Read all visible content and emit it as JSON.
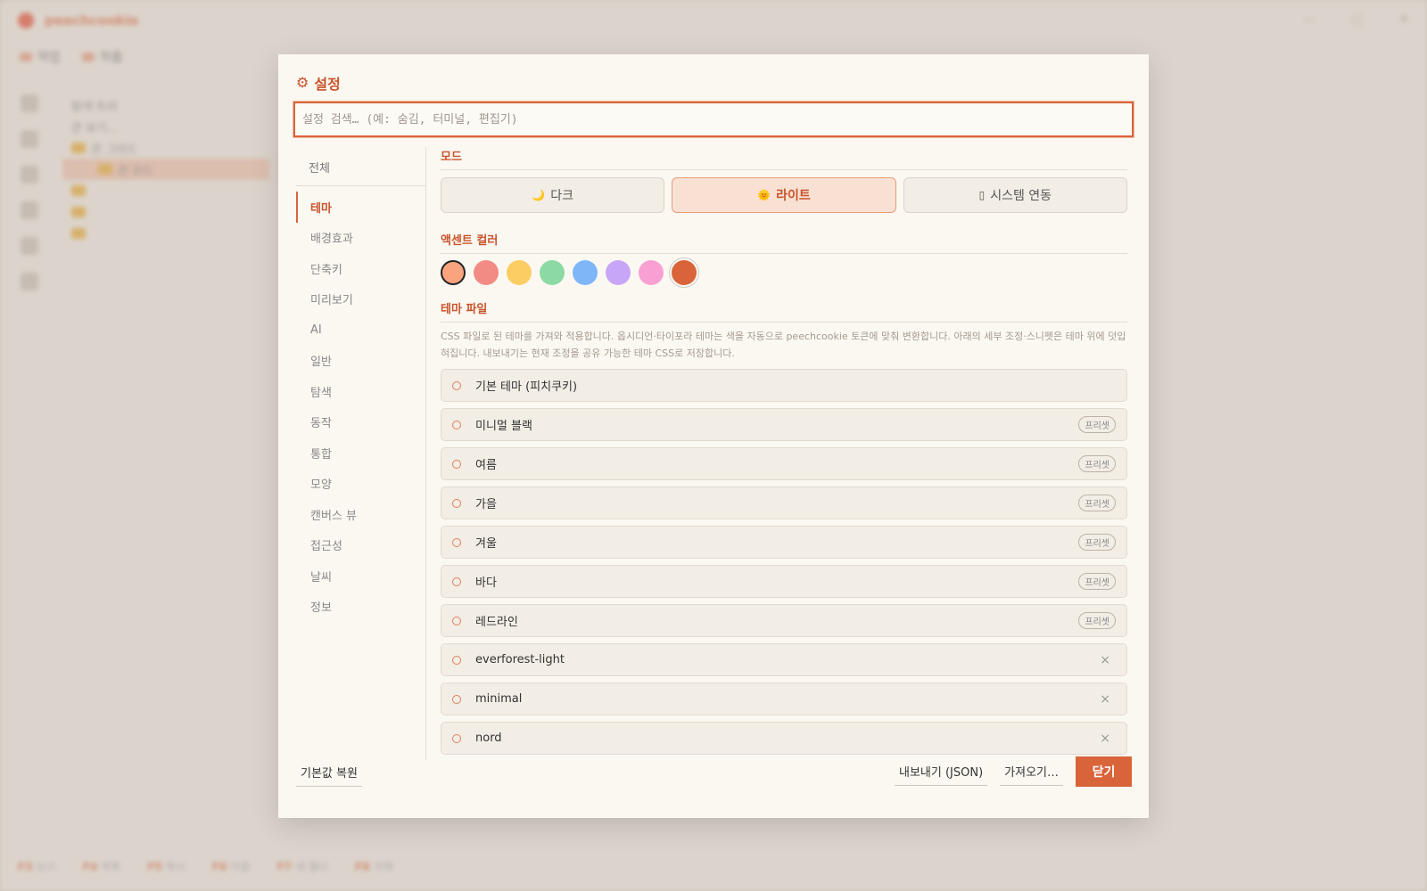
{
  "background": {
    "app_name": "peechcookie",
    "tabs": [
      "작업",
      "작품"
    ],
    "tree_rows": [
      "탐색 트리",
      "큰 보기...",
      "큰 그리드",
      "큰 모드"
    ],
    "status_items": [
      "보기",
      "목록",
      "복사",
      "이름",
      "새 폴더",
      "삭제"
    ]
  },
  "modal": {
    "title": "설정",
    "title_icon": "gear-icon",
    "search_placeholder": "설정 검색… (예: 숨김, 터미널, 편집기)",
    "nav_all": "전체",
    "nav_items": [
      "테마",
      "배경효과",
      "단축키",
      "미리보기",
      "AI",
      "일반",
      "탐색",
      "동작",
      "통합",
      "모양",
      "캔버스 뷰",
      "접근성",
      "날씨",
      "정보"
    ],
    "nav_active": "테마",
    "mode": {
      "title": "모드",
      "options": [
        {
          "label": "다크",
          "icon": "moon-icon",
          "glyph": "🌙"
        },
        {
          "label": "라이트",
          "icon": "sun-icon",
          "glyph": "🌞"
        },
        {
          "label": "시스템 연동",
          "icon": "monitor-icon",
          "glyph": "▯"
        }
      ],
      "active": "라이트"
    },
    "accent": {
      "title": "액센트 컬러",
      "colors": [
        "#f9a47f",
        "#f28b84",
        "#fbcd62",
        "#8dd9a3",
        "#7fb6f7",
        "#c8a6f7",
        "#f8a0d3",
        "#d9643a"
      ],
      "selected_index": 0
    },
    "theme_file": {
      "title": "테마 파일",
      "description": "CSS 파일로 된 테마를 가져와 적용합니다. 옵시디언·타이포라 테마는 색을 자동으로 peechcookie 토큰에 맞춰 변환합니다. 아래의 세부 조정·스니펫은 테마 위에 덧입혀집니다. 내보내기는 현재 조정을 공유 가능한 테마 CSS로 저장합니다.",
      "preset_badge": "프리셋",
      "remove_glyph": "×",
      "items": [
        {
          "name": "기본 테마 (피치쿠키)",
          "kind": "default"
        },
        {
          "name": "미니멀 블랙",
          "kind": "preset"
        },
        {
          "name": "여름",
          "kind": "preset"
        },
        {
          "name": "가을",
          "kind": "preset"
        },
        {
          "name": "겨울",
          "kind": "preset"
        },
        {
          "name": "바다",
          "kind": "preset"
        },
        {
          "name": "레드라인",
          "kind": "preset"
        },
        {
          "name": "everforest-light",
          "kind": "custom"
        },
        {
          "name": "minimal",
          "kind": "custom"
        },
        {
          "name": "nord",
          "kind": "custom"
        }
      ]
    },
    "footer": {
      "reset": "기본값 복원",
      "export": "내보내기 (JSON)",
      "import": "가져오기…",
      "close": "닫기"
    }
  }
}
